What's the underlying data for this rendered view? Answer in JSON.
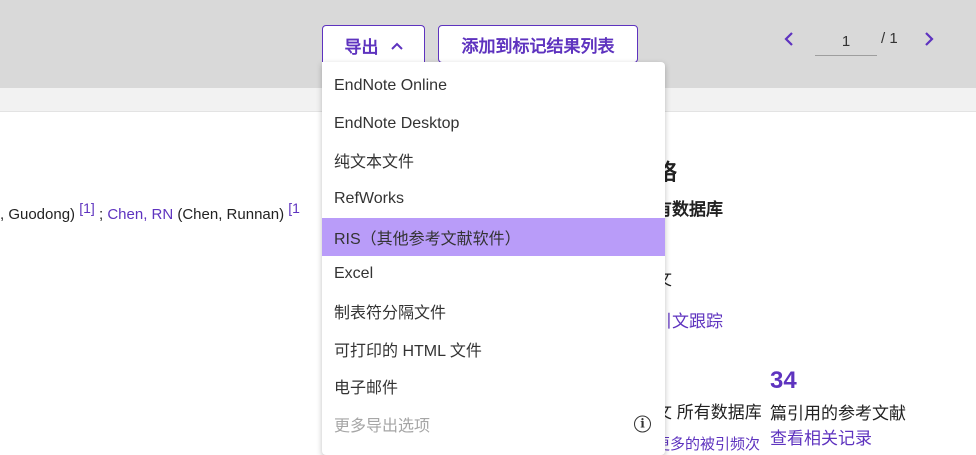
{
  "toolbar": {
    "export_label": "导出",
    "add_to_marked_label": "添加到标记结果列表",
    "pager": {
      "current_page": "1",
      "total": "/ 1"
    }
  },
  "export_menu": {
    "items": [
      {
        "label": "EndNote Online"
      },
      {
        "label": "EndNote Desktop"
      },
      {
        "label": "纯文本文件"
      },
      {
        "label": "RefWorks"
      },
      {
        "label": "RIS（其他参考文献软件）",
        "state": "highlighted"
      },
      {
        "label": "Excel"
      },
      {
        "label": "制表符分隔文件"
      },
      {
        "label": "可打印的 HTML 文件"
      },
      {
        "label": "电子邮件"
      },
      {
        "label": "更多导出选项",
        "state": "disabled"
      }
    ]
  },
  "record": {
    "author_fragment_1": ", Guodong)",
    "author_ref_1": "[1]",
    "separator": ";",
    "author_link": "Chen, RN",
    "author_full": "(Chen, Runnan)",
    "author_ref_2": "[1"
  },
  "sidebar": {
    "heading_fragment": "络",
    "subheading_fragment": "有数据库",
    "text_fragment": "文",
    "citation_link_fragment": "引文跟踪",
    "db_fragment": "文 所有数据库",
    "more_citations_fragment": "更多的被引频次",
    "references_count": "34",
    "references_label": "篇引用的参考文献",
    "references_link": "查看相关记录"
  },
  "colors": {
    "accent": "#5e33bf",
    "highlight": "#b99cf9",
    "toolbar_bg": "#d9d9d9"
  }
}
